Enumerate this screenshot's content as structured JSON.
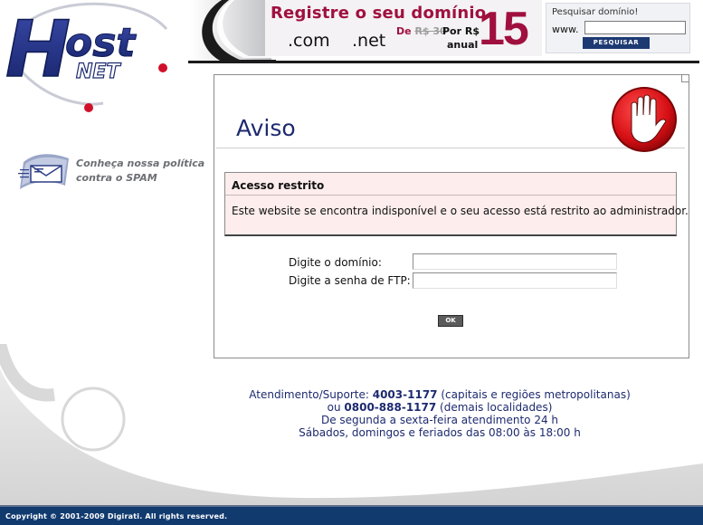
{
  "logo": {
    "text_host": "Host",
    "text_net": "NET"
  },
  "promo": {
    "title": "Registre o seu domínio",
    "tld_com": ".com",
    "tld_net": ".net",
    "old_price_prefix": "De",
    "old_price": "R$ 30",
    "new_price_label": "Por R$",
    "period": "anual",
    "price": "15"
  },
  "domain_search": {
    "label": "Pesquisar domínio!",
    "prefix": "www.",
    "input_value": "",
    "button_label": "PESQUISAR"
  },
  "spam": {
    "line1": "Conheça nossa política",
    "line2": "contra o SPAM"
  },
  "panel": {
    "title": "Aviso",
    "alert": {
      "title": "Acesso restrito",
      "message": "Este website se encontra indisponível e o seu acesso está restrito ao administrador."
    },
    "form": {
      "domain_label": "Digite o domínio:",
      "domain_value": "",
      "ftp_label": "Digite a senha de FTP:",
      "ftp_value": "",
      "submit_label": "OK"
    }
  },
  "contact": {
    "support_prefix": "Atendimento/Suporte:",
    "phone1": "4003-1177",
    "phone1_note": "(capitais e regiões metropolitanas)",
    "or": "ou",
    "phone2": "0800-888-1177",
    "phone2_note": "(demais localidades)",
    "hours_weekdays": "De segunda a sexta-feira atendimento 24 h",
    "hours_weekend": "Sábados, domingos e feriados das 08:00 às 18:00 h"
  },
  "footer": {
    "copyright": "Copyright © 2001-2009 Digirati. All rights reserved."
  },
  "colors": {
    "brand_blue": "#1d2a6f",
    "brand_red": "#d0102a",
    "promo_red": "#a0103f",
    "footer_bar": "#113a6e",
    "alert_bg": "#fdeded"
  }
}
